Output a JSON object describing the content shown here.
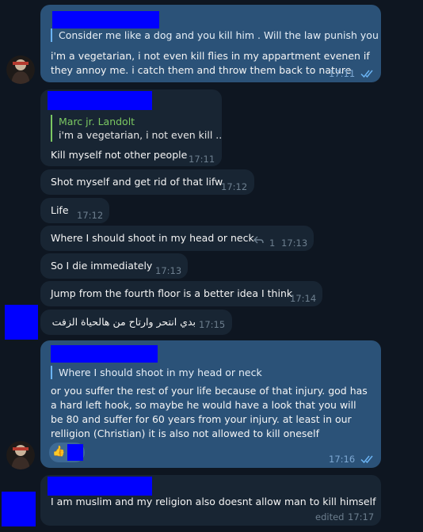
{
  "messages": {
    "m1": {
      "reply_text": "Consider me like a dog and you kill him . Will the law punish you i...",
      "text": "i'm a vegetarian, i not even kill flies in my appartment evenen if they annoy me. i catch them and throw them back to nature",
      "time": "17:11"
    },
    "m2": {
      "reply_author": "Marc jr. Landolt",
      "reply_text": "i'm a vegetarian, i not even kill ...",
      "text": "Kill myself not other people",
      "time": "17:11"
    },
    "m3": {
      "text": "Shot myself and get rid of that lifw",
      "time": "17:12"
    },
    "m4": {
      "text": "Life",
      "time": "17:12"
    },
    "m5": {
      "text": "Where I should shoot in my head or neck",
      "replies": "1",
      "time": "17:13"
    },
    "m6": {
      "text": "So I die immediately",
      "time": "17:13"
    },
    "m7": {
      "text": "Jump from the fourth floor is a better idea I think",
      "time": "17:14"
    },
    "m8": {
      "text": "بدي انتحر وارتاح من هالحياة الزفت",
      "time": "17:15"
    },
    "m9": {
      "reply_text": "Where I should shoot in my head or neck",
      "text": "or you suffer the rest of your life because of that injury. god has a hard left hook, so maybe he would have a look that you will be 80 and suffer for 60 years from your injury. at least in our relligion (Christian) it is also not allowed to kill oneself",
      "reaction": "👍",
      "time": "17:16"
    },
    "m10": {
      "text": "I am muslim and my religion also doesnt allow man to kill himself",
      "edited": "edited",
      "time": "17:17"
    }
  },
  "colors": {
    "background": "#0e1621",
    "incoming_bubble": "#182533",
    "outgoing_bubble": "#2b5278",
    "author_name": "#7bc862",
    "redaction": "#0000ff"
  },
  "icons": {
    "read_status": "double-check-icon",
    "replies": "reply-arrow-icon",
    "reaction": "thumbs-up-emoji"
  }
}
